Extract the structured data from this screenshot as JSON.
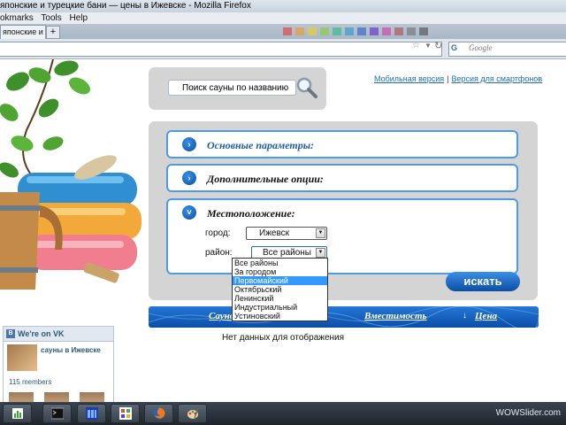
{
  "browser": {
    "title": "японские и турецкие бани — цены в Ижевске - Mozilla Firefox",
    "menu": [
      "okmarks",
      "Tools",
      "Help"
    ],
    "tab_title": "японские и т...",
    "new_tab": "+",
    "search_placeholder": "Google"
  },
  "header": {
    "links": [
      "Мобильная версия",
      "Версия для смартфонов"
    ],
    "separator": "|"
  },
  "sauna_search": {
    "placeholder": "Поиск сауны по названию"
  },
  "filters": {
    "sections": [
      {
        "title": "Основные параметры:",
        "expanded": false
      },
      {
        "title": "Дополнительные опции:",
        "expanded": false
      },
      {
        "title": "Местоположение:",
        "expanded": true
      }
    ],
    "city_label": "город:",
    "city_value": "Ижевск",
    "district_label": "район:",
    "district_value": "Все районы",
    "district_options": [
      "Все районы",
      "За городом",
      "Первомайский",
      "Октябрьский",
      "Ленинский",
      "Индустриальный",
      "Устиновский"
    ],
    "district_highlighted_index": 2,
    "search_button": "искать"
  },
  "results": {
    "columns": [
      "Сауна",
      "Вместимость",
      "Цена"
    ],
    "empty_message": "Нет данных для отображения"
  },
  "vk_widget": {
    "heading": "We're on VK",
    "logo": "B",
    "group_name": "сауны в Ижевске",
    "members": "115 members"
  },
  "taskbar": {
    "icons": [
      "chart-icon",
      "terminal-icon",
      "window-icon",
      "paint-icon",
      "firefox-icon",
      "paint-brush-icon"
    ],
    "watermark": "WOWSlider.com"
  }
}
